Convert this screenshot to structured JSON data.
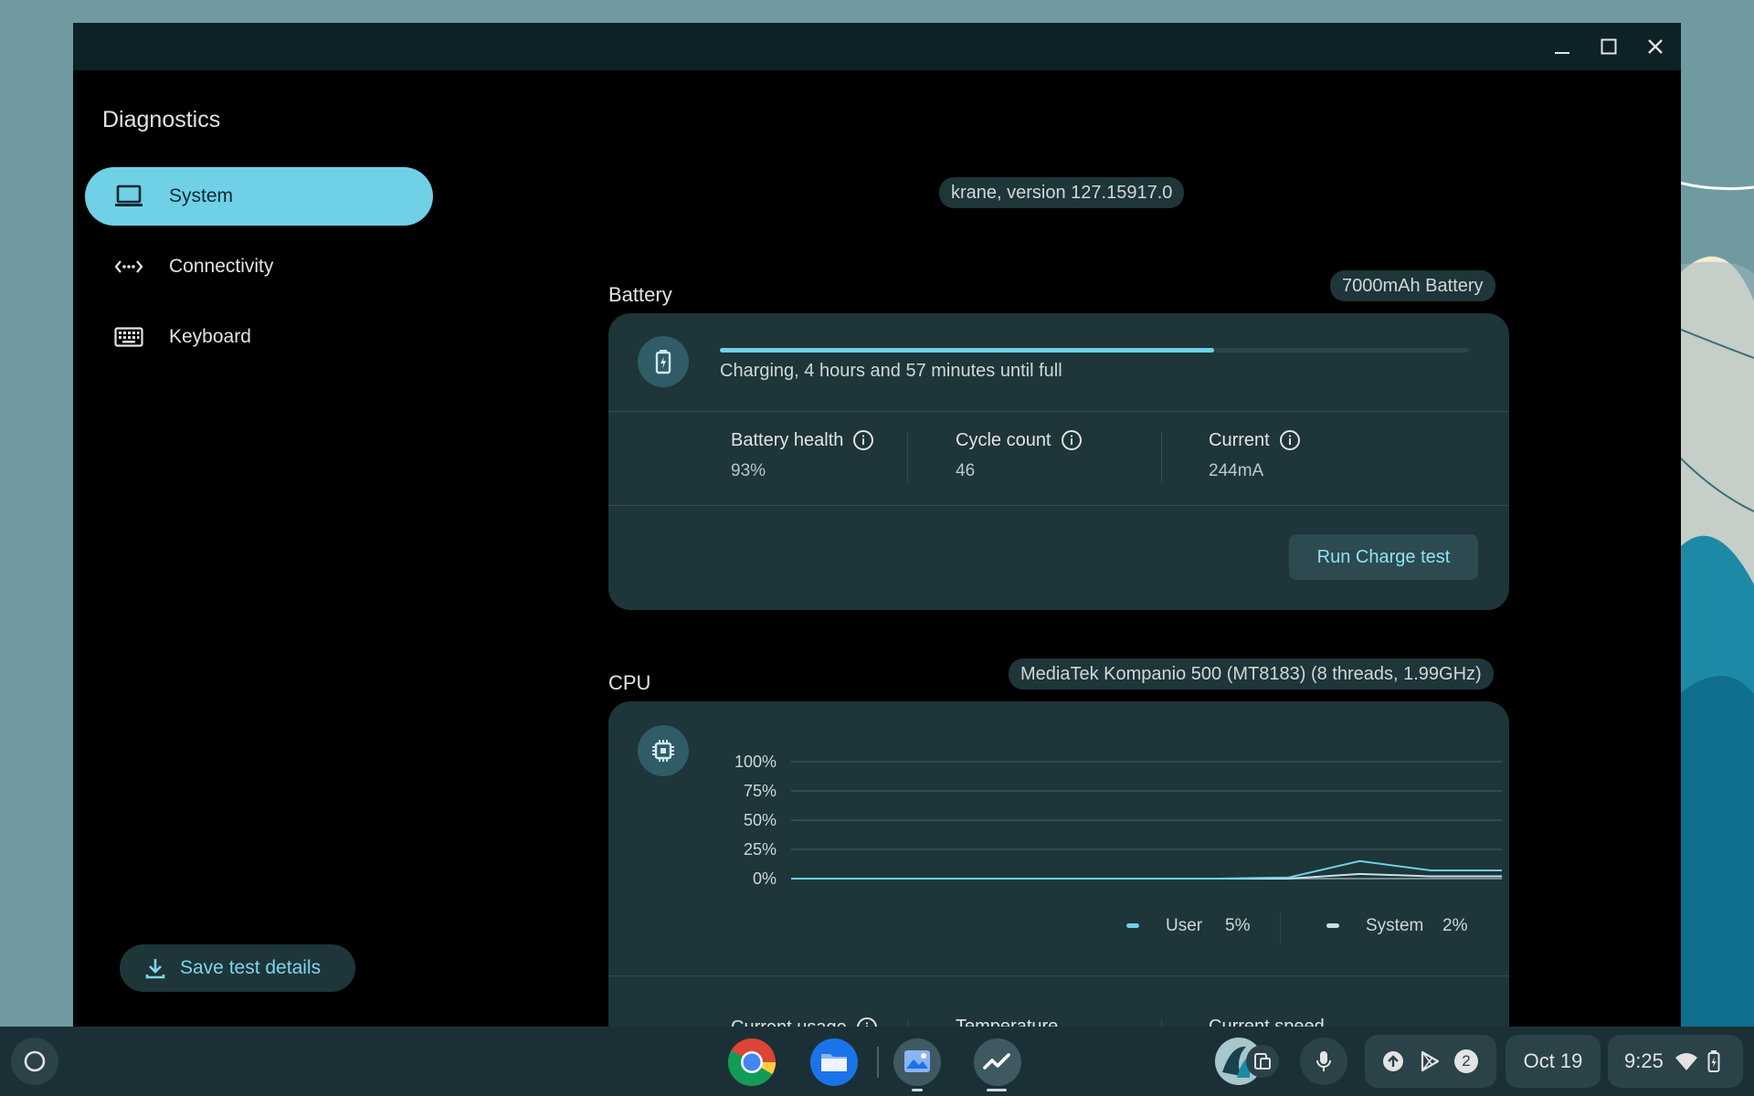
{
  "app": {
    "title": "Diagnostics"
  },
  "window_controls": {
    "icons": [
      "minimize-icon",
      "maximize-icon",
      "close-icon"
    ]
  },
  "sidebar": {
    "items": [
      {
        "label": "System",
        "icon": "laptop-icon",
        "active": true
      },
      {
        "label": "Connectivity",
        "icon": "connectivity-icon",
        "active": false
      },
      {
        "label": "Keyboard",
        "icon": "keyboard-icon",
        "active": false
      }
    ],
    "save_button": "Save test details"
  },
  "device": {
    "version": "krane, version 127.15917.0"
  },
  "battery": {
    "title": "Battery",
    "badge": "7000mAh Battery",
    "charge_progress": 0.66,
    "status": "Charging, 4 hours and 57 minutes until full",
    "stats": [
      {
        "label": "Battery health",
        "value": "93%"
      },
      {
        "label": "Cycle count",
        "value": "46"
      },
      {
        "label": "Current",
        "value": "244mA"
      }
    ],
    "run_button": "Run Charge test"
  },
  "cpu": {
    "title": "CPU",
    "badge": "MediaTek Kompanio 500 (MT8183) (8 threads, 1.99GHz)",
    "legend": [
      {
        "label": "User",
        "value": "5%",
        "color": "#6fd0e6"
      },
      {
        "label": "System",
        "value": "2%",
        "color": "#c2e2ea"
      }
    ],
    "stats": [
      {
        "label": "Current usage"
      },
      {
        "label": "Temperature"
      },
      {
        "label": "Current speed"
      }
    ]
  },
  "chart_data": {
    "type": "line",
    "title": "",
    "xlabel": "",
    "ylabel": "",
    "y_ticks": [
      "100%",
      "75%",
      "50%",
      "25%",
      "0%"
    ],
    "ylim": [
      0,
      100
    ],
    "x": [
      0,
      1,
      2,
      3,
      4,
      5,
      6,
      7,
      8,
      9,
      10
    ],
    "series": [
      {
        "name": "User",
        "values": [
          0,
          0,
          0,
          0,
          0,
          0,
          0,
          1,
          15,
          7,
          7
        ],
        "color": "#6fd0e6"
      },
      {
        "name": "System",
        "values": [
          0,
          0,
          0,
          0,
          0,
          0,
          0,
          0,
          4,
          2,
          2
        ],
        "color": "#c2e2ea"
      }
    ]
  },
  "shelf": {
    "apps": [
      "chrome-icon",
      "files-icon",
      "gallery-icon",
      "diagnostics-icon"
    ],
    "notification_count": "2",
    "date": "Oct 19",
    "time": "9:25"
  }
}
